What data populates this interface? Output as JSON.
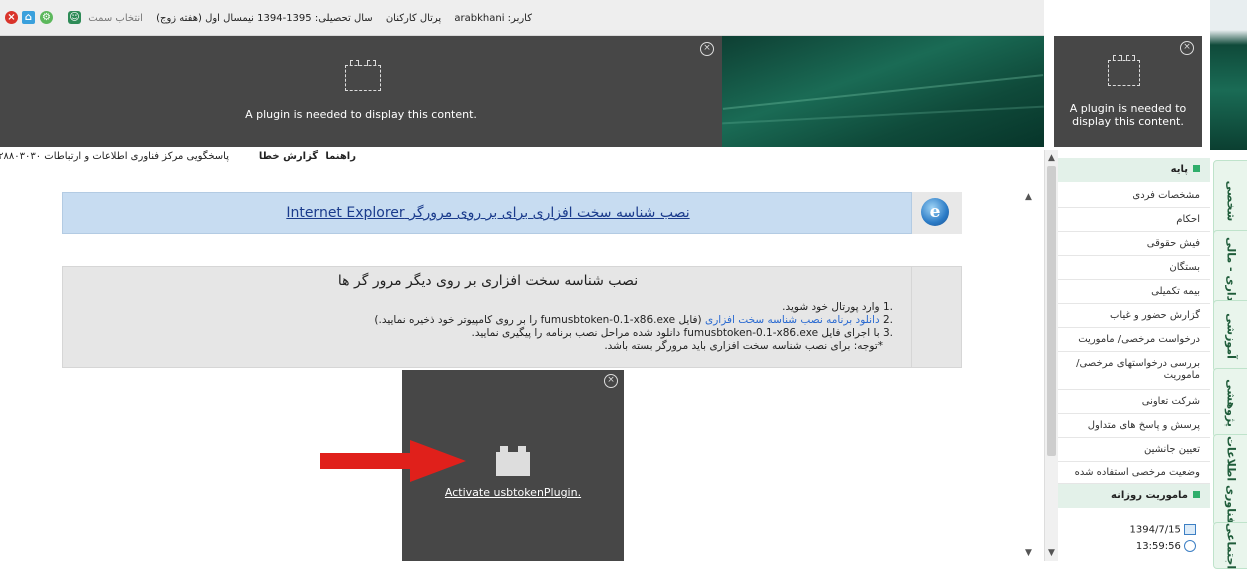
{
  "topbar": {
    "user_label": "کاربر: arabkhani",
    "portal_link": "پرتال کارکنان",
    "academic_year": "سال تحصیلی: 1395-1394 نیمسال اول (هفته زوج)",
    "select_role_link": "انتخاب سمت",
    "icons": [
      "close-icon",
      "home-icon",
      "settings-icon",
      "user-icon"
    ]
  },
  "plugin": {
    "message": "A plugin is needed to display this content.",
    "activate_link": "Activate usbtokenPlugin."
  },
  "links_bar": {
    "help": "راهنما",
    "report_error": "گزارش خطا",
    "support": "پاسخگویی مرکز فناوری اطلاعات و ارتباطات ۲۸۸۰۳۰۳۰"
  },
  "content": {
    "ie_link": "نصب شناسه سخت افزاری برای بر روی مرورگر Internet Explorer",
    "other_title": "نصب شناسه سخت افزاری بر روی دیگر مرور گر ها",
    "step1": "وارد پورتال خود شوید.",
    "step2_link": "دانلود برنامه نصب شناسه سخت افزاری",
    "step2_rest": " (فایل fumusbtoken-0.1-x86.exe را بر روی کامپیوتر خود ذخیره نمایید.)",
    "step3": "با اجرای فایل fumusbtoken-0.1-x86.exe دانلود شده مراحل نصب برنامه را پیگیری نمایید.",
    "note": "*توجه: برای نصب شناسه سخت افزاری باید مرورگر بسته باشد."
  },
  "sidebar": {
    "section_base": "پایه",
    "items": [
      "مشخصات فردی",
      "احکام",
      "فیش حقوقی",
      "بستگان",
      "بیمه تکمیلی",
      "گزارش حضور و غیاب",
      "درخواست مرخصی/ ماموریت",
      "بررسی درخواستهای مرخصی/ماموریت",
      "شرکت تعاونی",
      "پرسش و پاسخ های متداول",
      "تعیین جانشین",
      "وضعیت مرخصی استفاده شده"
    ],
    "section_daily": "ماموریت روزانه",
    "date": "1394/7/15",
    "time": "13:59:56"
  },
  "tabs": [
    "شخصی",
    "اداری - مالی",
    "آموزشی",
    "پژوهشی",
    "فناوری اطلاعات",
    "اجتماعی"
  ],
  "colors": {
    "plugin_bg": "#474747",
    "accent_green": "#2fae6b",
    "ie_box_bg": "#c7dcf1",
    "arrow_red": "#e0201b"
  }
}
